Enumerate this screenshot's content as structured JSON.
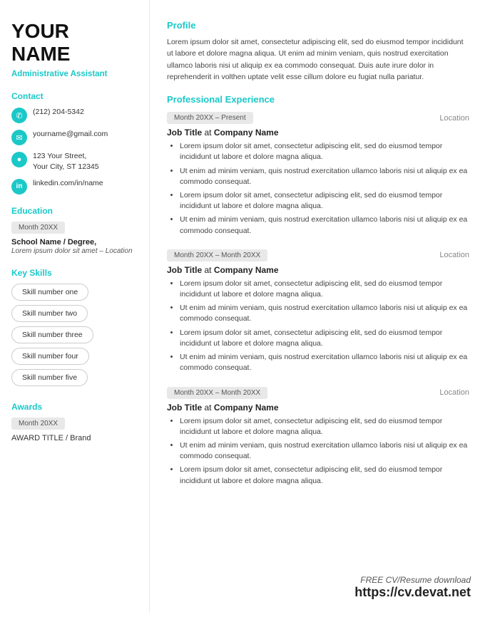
{
  "sidebar": {
    "name_line1": "YOUR",
    "name_line2": "NAME",
    "job_title": "Administrative Assistant",
    "contact_label": "Contact",
    "phone": "(212) 204-5342",
    "email": "yourname@gmail.com",
    "address_line1": "123 Your Street,",
    "address_line2": "Your City, ST 12345",
    "linkedin": "linkedin.com/in/name",
    "education_label": "Education",
    "edu_date": "Month 20XX",
    "edu_name": "School Name / Degree,",
    "edu_desc": "Lorem ipsum dolor sit amet – Location",
    "skills_label": "Key Skills",
    "skills": [
      "Skill number one",
      "Skill number two",
      "Skill number three",
      "Skill number four",
      "Skill number five"
    ],
    "awards_label": "Awards",
    "award_date": "Month 20XX",
    "award_title": "AWARD TITLE / Brand"
  },
  "main": {
    "profile_heading": "Profile",
    "profile_text": "Lorem ipsum dolor sit amet, consectetur adipiscing elit, sed do eiusmod tempor incididunt ut labore et dolore magna aliqua. Ut enim ad minim veniam, quis nostrud exercitation ullamco laboris nisi ut aliquip ex ea commodo consequat. Duis aute irure dolor in reprehenderit in volthen uptate velit esse cillum dolore eu fugiat nulla pariatur.",
    "experience_heading": "Professional Experience",
    "jobs": [
      {
        "date": "Month 20XX – Present",
        "location": "Location",
        "title": "Job Title",
        "company": "Company Name",
        "bullets": [
          "Lorem ipsum dolor sit amet, consectetur adipiscing elit, sed do eiusmod tempor incididunt ut labore et dolore magna aliqua.",
          "Ut enim ad minim veniam, quis nostrud exercitation ullamco laboris nisi ut aliquip ex ea commodo consequat.",
          "Lorem ipsum dolor sit amet, consectetur adipiscing elit, sed do eiusmod tempor incididunt ut labore et dolore magna aliqua.",
          "Ut enim ad minim veniam, quis nostrud exercitation ullamco laboris nisi ut aliquip ex ea commodo consequat."
        ]
      },
      {
        "date": "Month 20XX – Month 20XX",
        "location": "Location",
        "title": "Job Title",
        "company": "Company Name",
        "bullets": [
          "Lorem ipsum dolor sit amet, consectetur adipiscing elit, sed do eiusmod tempor incididunt ut labore et dolore magna aliqua.",
          "Ut enim ad minim veniam, quis nostrud exercitation ullamco laboris nisi ut aliquip ex ea commodo consequat.",
          "Lorem ipsum dolor sit amet, consectetur adipiscing elit, sed do eiusmod tempor incididunt ut labore et dolore magna aliqua.",
          "Ut enim ad minim veniam, quis nostrud exercitation ullamco laboris nisi ut aliquip ex ea commodo consequat."
        ]
      },
      {
        "date": "Month 20XX – Month 20XX",
        "location": "Location",
        "title": "Job Title",
        "company": "Company Name",
        "bullets": [
          "Lorem ipsum dolor sit amet, consectetur adipiscing elit, sed do eiusmod tempor incididunt ut labore et dolore magna aliqua.",
          "Ut enim ad minim veniam, quis nostrud exercitation ullamco laboris nisi ut aliquip ex ea commodo consequat.",
          "Lorem ipsum dolor sit amet, consectetur adipiscing elit, sed do eiusmod tempor incididunt ut labore et dolore magna aliqua."
        ]
      }
    ]
  },
  "footer": {
    "free_line": "FREE CV/Resume download",
    "url": "https://cv.devat.net"
  }
}
